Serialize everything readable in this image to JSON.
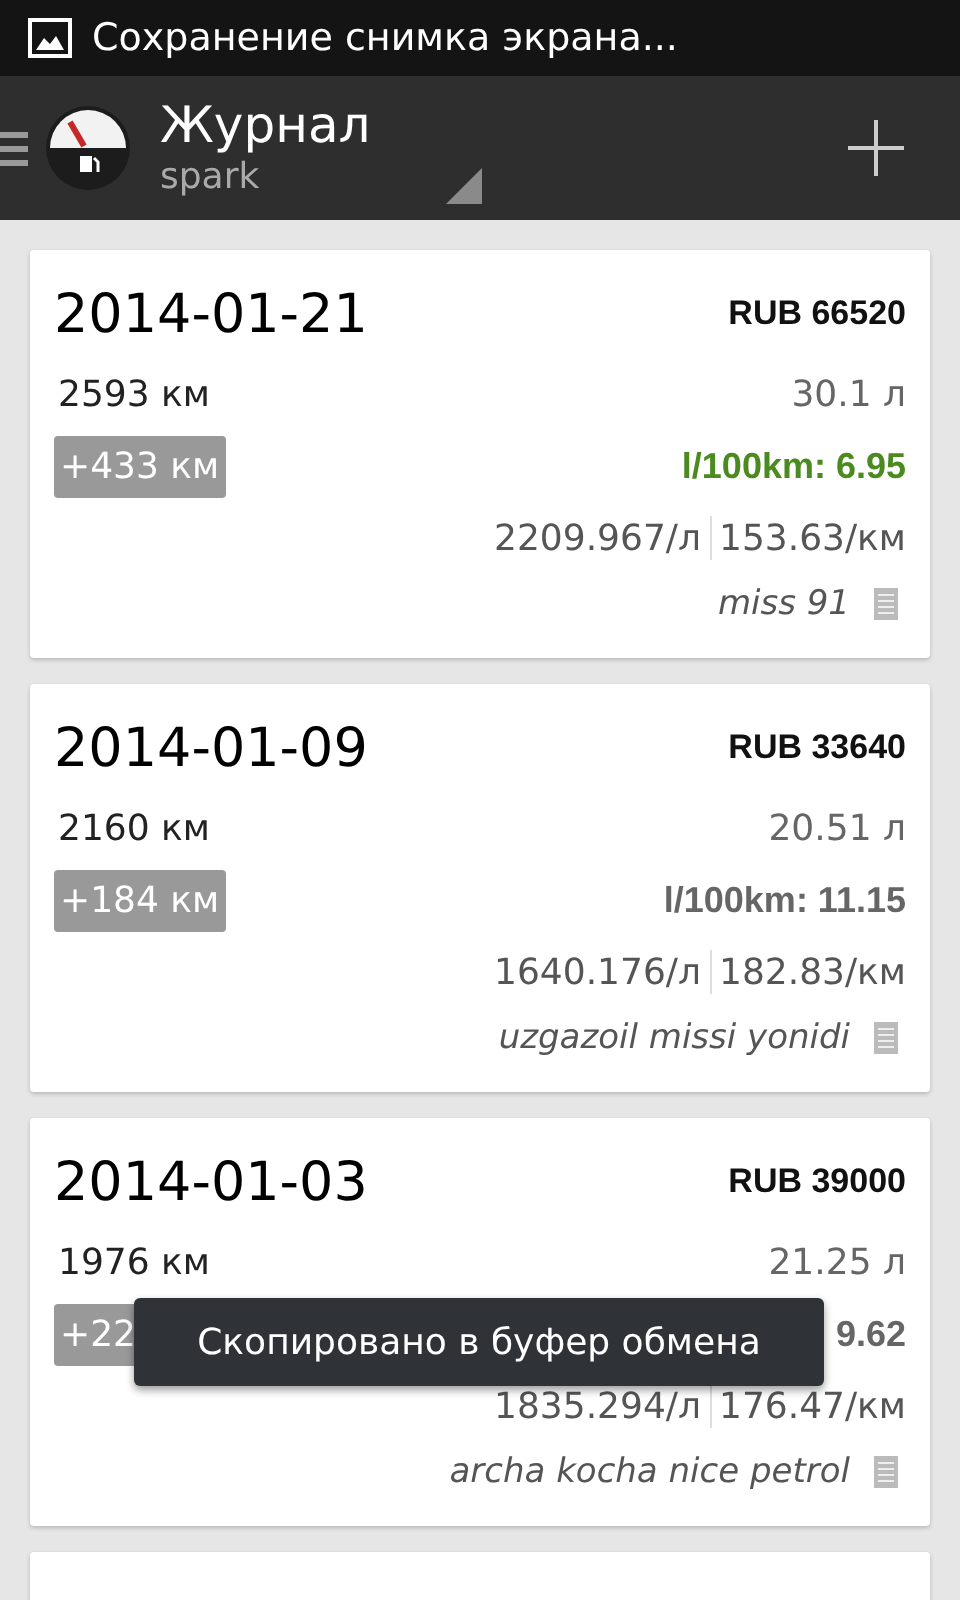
{
  "status_bar": {
    "notification": "Сохранение снимка экрана..."
  },
  "action_bar": {
    "title": "Журнал",
    "subtitle": "spark"
  },
  "entries": [
    {
      "date": "2014-01-21",
      "cost": "RUB 66520",
      "odometer": "2593 км",
      "volume": "30.1 л",
      "distance": "+433 км",
      "efficiency": "l/100km: 6.95",
      "good": true,
      "price_per_liter": "2209.967/л",
      "price_per_km": "153.63/км",
      "note": "miss 91"
    },
    {
      "date": "2014-01-09",
      "cost": "RUB 33640",
      "odometer": "2160 км",
      "volume": "20.51 л",
      "distance": "+184 км",
      "efficiency": "l/100km: 11.15",
      "good": false,
      "price_per_liter": "1640.176/л",
      "price_per_km": "182.83/км",
      "note": "uzgazoil missi yonidi"
    },
    {
      "date": "2014-01-03",
      "cost": "RUB 39000",
      "odometer": "1976 км",
      "volume": "21.25 л",
      "distance": "+22",
      "efficiency": "9.62",
      "good": false,
      "price_per_liter": "1835.294/л",
      "price_per_km": "176.47/км",
      "note": "archa kocha nice petrol"
    }
  ],
  "toast": "Скопировано в буфер обмена"
}
